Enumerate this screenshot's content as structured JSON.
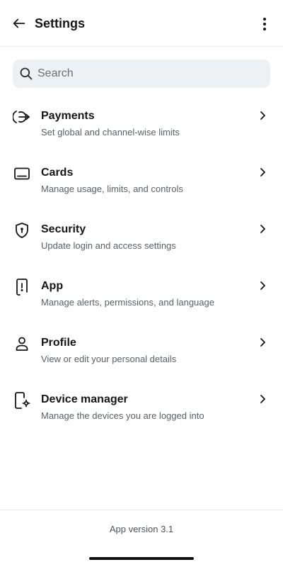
{
  "header": {
    "title": "Settings",
    "back_icon": "arrow-left-icon",
    "more_icon": "more-vertical-icon"
  },
  "search": {
    "placeholder": "Search",
    "value": "",
    "icon": "search-icon"
  },
  "menu": {
    "items": [
      {
        "id": "payments",
        "icon": "payments-icon",
        "title": "Payments",
        "subtitle": "Set global and channel-wise limits"
      },
      {
        "id": "cards",
        "icon": "card-icon",
        "title": "Cards",
        "subtitle": "Manage usage, limits, and controls"
      },
      {
        "id": "security",
        "icon": "shield-icon",
        "title": "Security",
        "subtitle": "Update login and access settings"
      },
      {
        "id": "app",
        "icon": "phone-alert-icon",
        "title": "App",
        "subtitle": "Manage alerts, permissions, and language"
      },
      {
        "id": "profile",
        "icon": "user-icon",
        "title": "Profile",
        "subtitle": "View or edit your personal details"
      },
      {
        "id": "device-manager",
        "icon": "device-settings-icon",
        "title": "Device manager",
        "subtitle": "Manage the devices you are logged into"
      }
    ]
  },
  "footer": {
    "version_text": "App version 3.1"
  },
  "colors": {
    "title": "#161616",
    "subtitle": "#5b6066",
    "search_bg": "#eef1f4",
    "divider": "#e8eaed"
  }
}
